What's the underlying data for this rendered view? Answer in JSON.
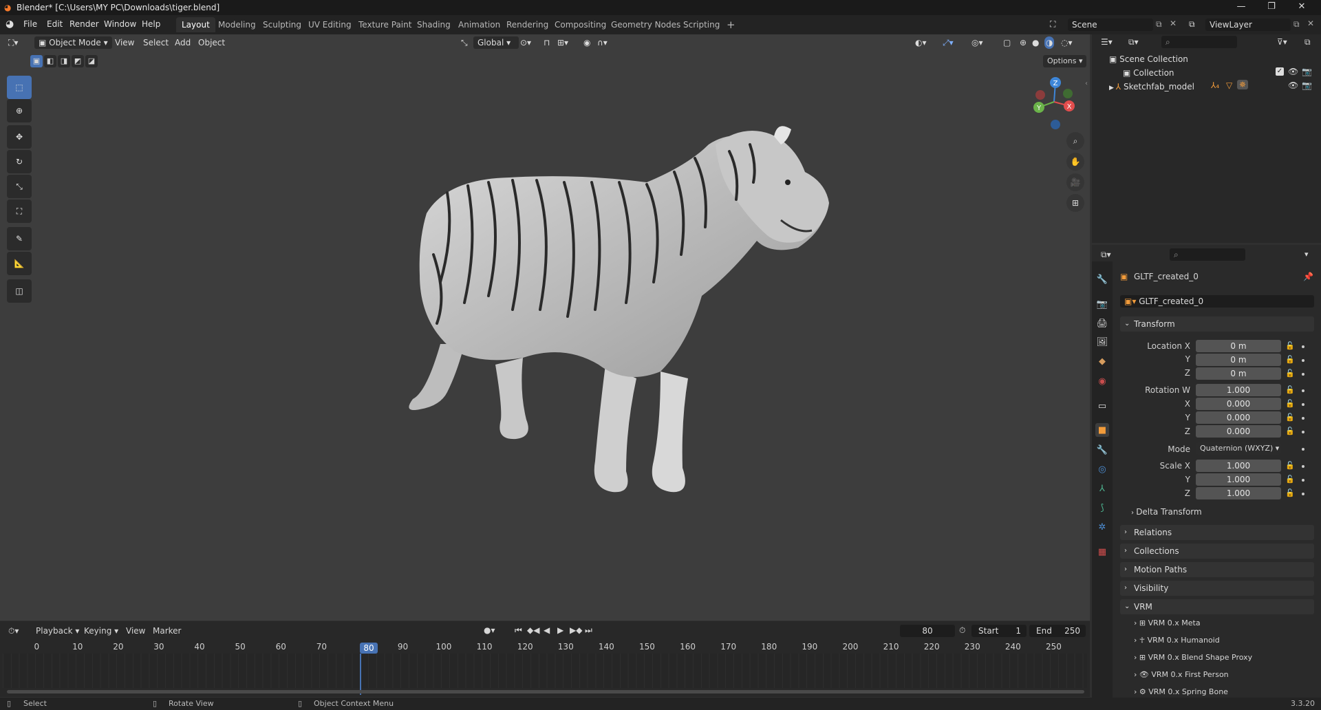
{
  "window": {
    "title": "Blender* [C:\\Users\\MY PC\\Downloads\\tiger.blend]"
  },
  "menus": [
    "File",
    "Edit",
    "Render",
    "Window",
    "Help"
  ],
  "workspaces": [
    "Layout",
    "Modeling",
    "Sculpting",
    "UV Editing",
    "Texture Paint",
    "Shading",
    "Animation",
    "Rendering",
    "Compositing",
    "Geometry Nodes",
    "Scripting"
  ],
  "scene": {
    "name": "Scene",
    "view_layer": "ViewLayer"
  },
  "viewport": {
    "mode": "Object Mode",
    "menus": [
      "View",
      "Select",
      "Add",
      "Object"
    ],
    "transform_orientation": "Global",
    "options_label": "Options",
    "gizmo_axes": [
      "Z",
      "Y",
      "X"
    ]
  },
  "outliner": {
    "scene_collection": "Scene Collection",
    "collection": "Collection",
    "object": "Sketchfab_model"
  },
  "properties": {
    "object_name": "GLTF_created_0",
    "data_name": "GLTF_created_0",
    "transform_header": "Transform",
    "location": {
      "label": "Location X",
      "x": "0 m",
      "y": "0 m",
      "z": "0 m"
    },
    "rotation": {
      "label": "Rotation W",
      "w": "1.000",
      "x": "0.000",
      "y": "0.000",
      "z": "0.000"
    },
    "mode_label": "Mode",
    "mode_value": "Quaternion (WXYZ)",
    "scale": {
      "label": "Scale X",
      "x": "1.000",
      "y": "1.000",
      "z": "1.000"
    },
    "axis_y": "Y",
    "axis_z": "Z",
    "axis_x": "X",
    "sections": [
      "Delta Transform",
      "Relations",
      "Collections",
      "Motion Paths",
      "Visibility",
      "VRM"
    ],
    "vrm_items": [
      "VRM 0.x Meta",
      "VRM 0.x Humanoid",
      "VRM 0.x Blend Shape Proxy",
      "VRM 0.x First Person",
      "VRM 0.x Spring Bone"
    ]
  },
  "timeline": {
    "menus": [
      "Playback",
      "Keying",
      "View",
      "Marker"
    ],
    "current_frame": "80",
    "start_label": "Start",
    "start": "1",
    "end_label": "End",
    "end": "250",
    "ticks": [
      "0",
      "10",
      "20",
      "30",
      "40",
      "50",
      "60",
      "70",
      "80",
      "90",
      "100",
      "110",
      "120",
      "130",
      "140",
      "150",
      "160",
      "170",
      "180",
      "190",
      "200",
      "210",
      "220",
      "230",
      "240",
      "250"
    ]
  },
  "statusbar": {
    "select": "Select",
    "rotate": "Rotate View",
    "context": "Object Context Menu",
    "version": "3.3.20"
  },
  "colors": {
    "accent": "#4772b3",
    "background": "#303030",
    "viewport": "#3d3d3d",
    "x_axis": "#e24d4d",
    "y_axis": "#6bb34a",
    "z_axis": "#3e86d8"
  }
}
